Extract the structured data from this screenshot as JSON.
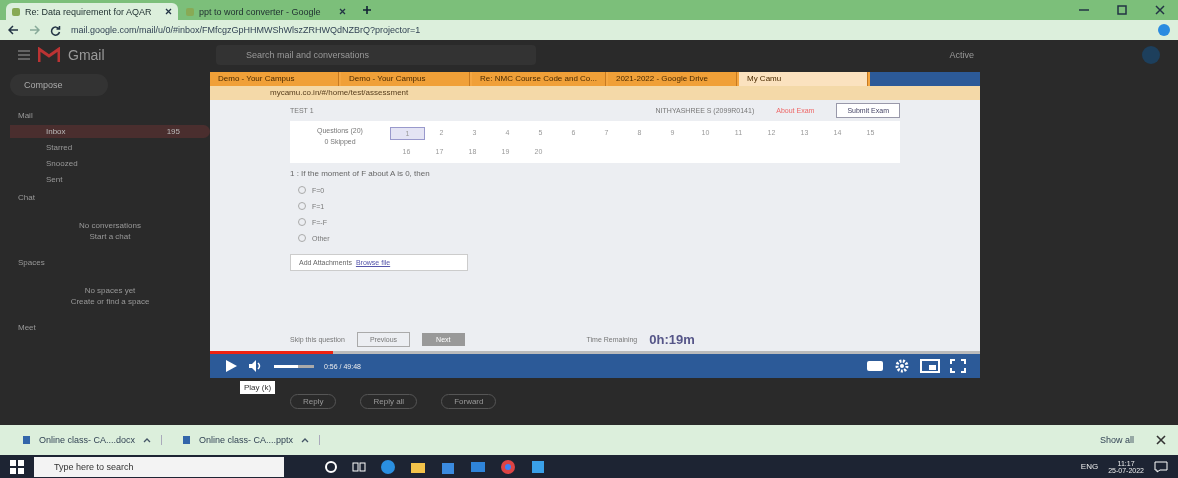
{
  "browser": {
    "tabs": [
      {
        "title": "Re: Data requirement for AQAR",
        "selected": true
      },
      {
        "title": "ppt to word converter - Google",
        "selected": false
      }
    ],
    "url": "mail.google.com/mail/u/0/#inbox/FMfcgzGpHHMWShWlszZRHWQdNZBrQ?projector=1"
  },
  "gmail": {
    "logo": "Gmail",
    "search_placeholder": "Search mail and conversations",
    "status": "Active",
    "compose": "Compose",
    "sections": [
      {
        "title": "Mail",
        "items": [
          {
            "label": "Inbox",
            "count": "195",
            "selected": true
          },
          {
            "label": "Starred",
            "selected": false
          },
          {
            "label": "Snoozed",
            "selected": false
          },
          {
            "label": "Sent",
            "selected": false
          }
        ]
      },
      {
        "title": "Chat",
        "empty": [
          "No conversations",
          "Start a chat"
        ]
      },
      {
        "title": "Spaces",
        "empty": [
          "No spaces yet",
          "Create or find a space"
        ]
      },
      {
        "title": "Meet"
      }
    ],
    "reply_buttons": [
      "Reply",
      "Reply all",
      "Forward"
    ]
  },
  "video": {
    "tabs": [
      {
        "title": "Demo - Your Campus",
        "selected": false
      },
      {
        "title": "Demo - Your Campus",
        "selected": false
      },
      {
        "title": "Re: NMC Course Code and Co...",
        "selected": false
      },
      {
        "title": "2021-2022 - Google Drive",
        "selected": false
      },
      {
        "title": "My Camu",
        "selected": true
      }
    ],
    "url": "mycamu.co.in/#/home/test/assessment",
    "exam": {
      "title": "TEST 1",
      "student": "NITHYASHREE S (2099R0141)",
      "about": "About Exam",
      "submit": "Submit Exam",
      "questions_label": "Questions (20)",
      "skipped": "0 Skipped",
      "numbers": [
        {
          "label": "1",
          "selected": true
        },
        {
          "label": "2",
          "selected": false
        },
        {
          "label": "3",
          "selected": false
        },
        {
          "label": "4",
          "selected": false
        },
        {
          "label": "5",
          "selected": false
        },
        {
          "label": "6",
          "selected": false
        },
        {
          "label": "7",
          "selected": false
        },
        {
          "label": "8",
          "selected": false
        },
        {
          "label": "9",
          "selected": false
        },
        {
          "label": "10",
          "selected": false
        },
        {
          "label": "11",
          "selected": false
        },
        {
          "label": "12",
          "selected": false
        },
        {
          "label": "13",
          "selected": false
        },
        {
          "label": "14",
          "selected": false
        },
        {
          "label": "15",
          "selected": false
        },
        {
          "label": "16",
          "selected": false
        },
        {
          "label": "17",
          "selected": false
        },
        {
          "label": "18",
          "selected": false
        },
        {
          "label": "19",
          "selected": false
        },
        {
          "label": "20",
          "selected": false
        }
      ],
      "question": "1 : If the moment of F about A is 0, then",
      "options": [
        {
          "label": "F=0",
          "checked": false
        },
        {
          "label": "F=1",
          "checked": false
        },
        {
          "label": "F=-F",
          "checked": false
        },
        {
          "label": "Other",
          "checked": false
        }
      ],
      "attach": "Add Attachments",
      "browse": "Browse file",
      "skip": "Skip this question",
      "previous": "Previous",
      "next": "Next",
      "time_label": "Time Remaining",
      "time": "0h:19m"
    },
    "player": {
      "level": 0.16,
      "volume": {
        "level": 0.6
      },
      "time": "0:56 / 49:48",
      "tooltip": "Play (k)"
    }
  },
  "downloads": {
    "files": [
      "Online class- CA....docx",
      "Online class- CA....pptx"
    ],
    "show_all": "Show all"
  },
  "taskbar": {
    "search_placeholder": "Type here to search",
    "lang": "ENG",
    "time": "11:17",
    "date": "25-07-2022"
  }
}
